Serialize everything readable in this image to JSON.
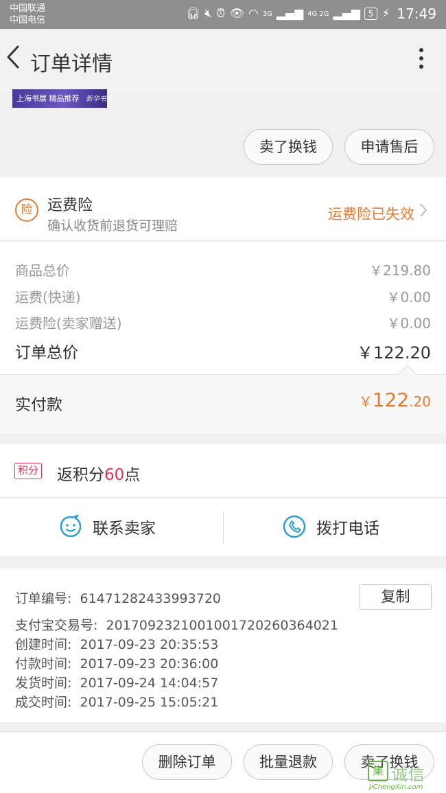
{
  "status_bar": {
    "carrier_1": "中国联通",
    "carrier_2": "中国电信",
    "network_1": "3G",
    "network_2": "4G 2G",
    "battery": "5",
    "time": "17:49"
  },
  "nav": {
    "title": "订单详情"
  },
  "banner": {
    "text": "上海书展 精品推荐",
    "signature": "新华书店"
  },
  "top_actions": {
    "sell_label": "卖了换钱",
    "after_sale_label": "申请售后"
  },
  "insurance": {
    "icon_text": "险",
    "title": "运费险",
    "subtitle": "确认收货前退货可理赔",
    "status": "运费险已失效"
  },
  "prices": {
    "rows": [
      {
        "label": "商品总价",
        "value": "￥219.80"
      },
      {
        "label": "运费(快递)",
        "value": "￥0.00"
      },
      {
        "label": "运费险(卖家赠送)",
        "value": "￥0.00"
      }
    ],
    "total_label": "订单总价",
    "total_value": "￥122.20"
  },
  "paid": {
    "label": "实付款",
    "currency": "￥",
    "integer": "122",
    "decimal": ".20"
  },
  "points": {
    "badge": "积分",
    "prefix": "返积分",
    "amount": "60",
    "suffix": "点"
  },
  "contact": {
    "seller_label": "联系卖家",
    "phone_label": "拨打电话"
  },
  "order_info": {
    "rows": [
      {
        "label": "订单编号:",
        "value": "61471282433993720"
      },
      {
        "label": "支付宝交易号:",
        "value": "2017092321001001720260364021"
      },
      {
        "label": "创建时间:",
        "value": "2017-09-23 20:35:53"
      },
      {
        "label": "付款时间:",
        "value": "2017-09-23 20:36:00"
      },
      {
        "label": "发货时间:",
        "value": "2017-09-24 14:04:57"
      },
      {
        "label": "成交时间:",
        "value": "2017-09-25 15:05:21"
      }
    ],
    "copy_label": "复制"
  },
  "bottom_actions": {
    "delete_label": "删除订单",
    "batch_refund_label": "批量退款",
    "sell_label": "卖了换钱"
  },
  "watermark": {
    "logo": "集",
    "name_cn": "诚信",
    "name_en": "JiChengXin.com"
  },
  "colors": {
    "accent_orange": "#e67a30",
    "points_red": "#d9345a",
    "contact_blue": "#2a9fd6"
  }
}
